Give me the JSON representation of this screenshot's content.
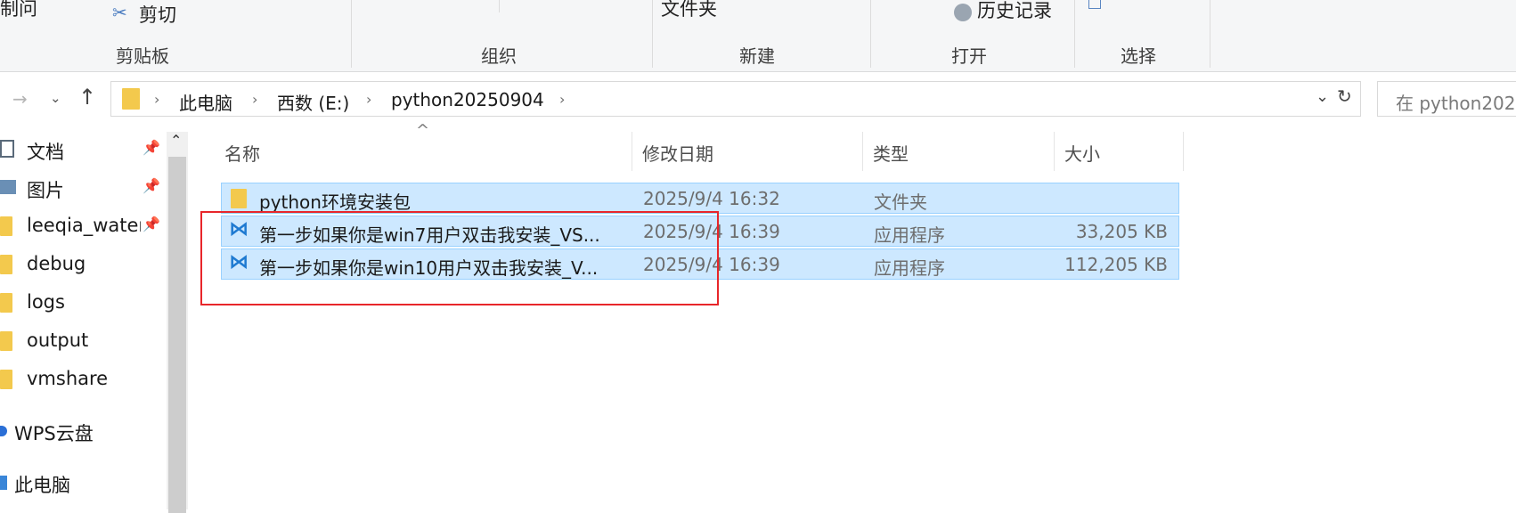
{
  "ribbon": {
    "clipboard": {
      "partial_left": "制问",
      "cut_label": "剪切",
      "group_label": "剪贴板"
    },
    "organize": {
      "group_label": "组织"
    },
    "new": {
      "folder_partial": "文件夹",
      "group_label": "新建"
    },
    "open": {
      "history_label": "历史记录",
      "group_label": "打开"
    },
    "select": {
      "group_label": "选择"
    }
  },
  "address": {
    "breadcrumbs": [
      "此电脑",
      "西数 (E:)",
      "python20250904"
    ],
    "search_placeholder": "在 python202"
  },
  "sidebar": {
    "items": [
      {
        "label": "文档",
        "icon": "document-icon",
        "pinned": true
      },
      {
        "label": "图片",
        "icon": "picture-icon",
        "pinned": true
      },
      {
        "label": "leeqia_water",
        "icon": "folder-icon",
        "pinned": true
      },
      {
        "label": "debug",
        "icon": "folder-icon"
      },
      {
        "label": "logs",
        "icon": "folder-icon"
      },
      {
        "label": "output",
        "icon": "folder-icon"
      },
      {
        "label": "vmshare",
        "icon": "folder-icon"
      },
      {
        "label": "WPS云盘",
        "icon": "cloud-icon"
      },
      {
        "label": "此电脑",
        "icon": "computer-icon"
      }
    ]
  },
  "filelist": {
    "columns": {
      "name": "名称",
      "modified": "修改日期",
      "type": "类型",
      "size": "大小"
    },
    "rows": [
      {
        "name": "python环境安装包",
        "modified": "2025/9/4 16:32",
        "type": "文件夹",
        "size": "",
        "icon": "folder-icon"
      },
      {
        "name": "第一步如果你是win7用户双击我安装_VS...",
        "modified": "2025/9/4 16:39",
        "type": "应用程序",
        "size": "33,205 KB",
        "icon": "vscode-icon"
      },
      {
        "name": "第一步如果你是win10用户双击我安装_V...",
        "modified": "2025/9/4 16:39",
        "type": "应用程序",
        "size": "112,205 KB",
        "icon": "vscode-icon"
      }
    ]
  },
  "colors": {
    "selection": "#cde8ff",
    "selection_border": "#99d1ff",
    "highlight_box": "#e8262a",
    "folder": "#f3c94d",
    "vscode_blue": "#1f7ad1"
  }
}
